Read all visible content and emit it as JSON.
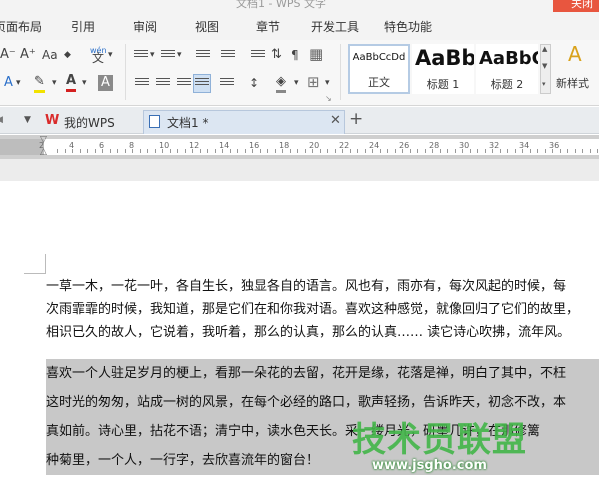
{
  "window": {
    "title": "文档1 - WPS 文字",
    "close_label": "关闭"
  },
  "ribbon_tabs": [
    {
      "label": "页面布局"
    },
    {
      "label": "引用"
    },
    {
      "label": "审阅"
    },
    {
      "label": "视图"
    },
    {
      "label": "章节"
    },
    {
      "label": "开发工具"
    },
    {
      "label": "特色功能"
    }
  ],
  "ribbon": {
    "pinyin_label": "wén",
    "styles": [
      {
        "sample": "AaBbCcDd",
        "name": "正文"
      },
      {
        "sample": "AaBb",
        "name": "标题 1"
      },
      {
        "sample": "AaBbC",
        "name": "标题 2"
      }
    ],
    "new_style_label": "新样式"
  },
  "doc_tabs": [
    {
      "label": "我的WPS"
    },
    {
      "label": "文档1 *"
    }
  ],
  "ruler": {
    "numbers": [
      "2",
      "2",
      "4",
      "6",
      "8",
      "10",
      "12",
      "14",
      "16",
      "18",
      "20",
      "22",
      "24",
      "26",
      "28",
      "30",
      "32",
      "34",
      "36"
    ]
  },
  "document": {
    "paragraph1": [
      "一草一木，一花一叶，各自生长，独显各自的语言。风也有，雨亦有，每次风起的时候，每",
      "次雨霏霏的时候，我知道，那是它们在和你我对语。喜欢这种感觉，就像回归了它们的故里，",
      "相识已久的故人，它说着，我听着，那么的认真，那么的认真…… 读它诗心吹拂，流年风。"
    ],
    "paragraph2": [
      "喜欢一个人驻足岁月的梗上，看那一朵花的去留，花开是缘，花落是禅，明白了其中，不枉",
      "这时光的匆匆，站成一树的风景，在每个必经的路口，歌声轻扬，告诉昨天，初念不改，本",
      "真如前。诗心里，拈花不语；清宁中，读水色天长。采一缕月光，研墨几许，在那修篱",
      "种菊里，一个人，一行字，去欣喜流年的窗台！"
    ]
  },
  "watermark": {
    "text": "技术员联盟",
    "url": "www.jsgho.com"
  }
}
